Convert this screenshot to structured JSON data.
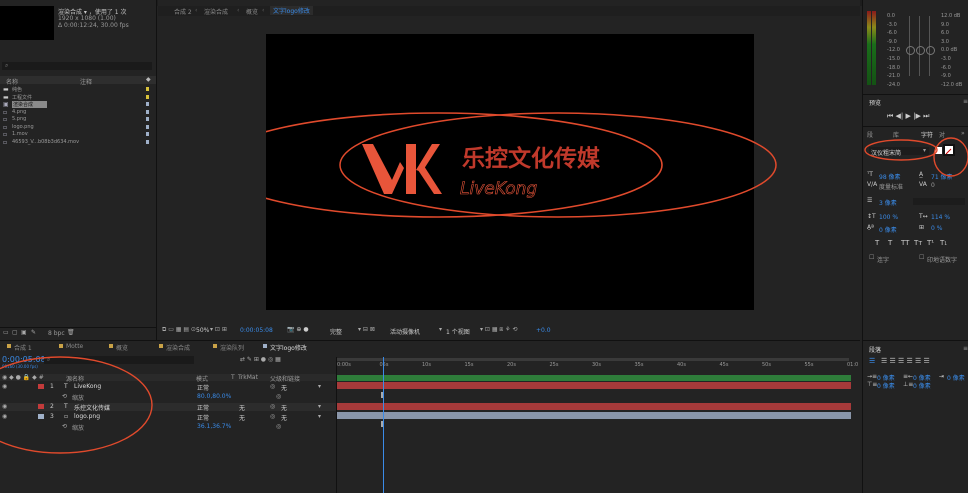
{
  "project": {
    "footage_info": [
      "渲染合成 ▾ ，使用了 1 次",
      "1920 x 1080 (1.00)",
      "Δ 0:00:12:24, 30.00 fps"
    ],
    "search_placeholder": "⌕",
    "col_name": "名称",
    "col_comment": "注释",
    "items": [
      {
        "name": "纯色",
        "type": "folder",
        "color": "#d8c23a"
      },
      {
        "name": "工程文件",
        "type": "folder",
        "color": "#d8c23a"
      },
      {
        "name": "渲染合成",
        "type": "comp",
        "color": "#9fb0c8",
        "selected": true
      },
      {
        "name": "4.png",
        "type": "file",
        "color": "#9fb0c8"
      },
      {
        "name": "5.png",
        "type": "file",
        "color": "#9fb0c8"
      },
      {
        "name": "logo.png",
        "type": "file",
        "color": "#9fb0c8"
      },
      {
        "name": "1.mov",
        "type": "file",
        "color": "#9fb0c8"
      },
      {
        "name": "46593_V...b08b3d634.mov",
        "type": "file",
        "color": "#9fb0c8"
      }
    ],
    "bpc": "8 bpc"
  },
  "comp": {
    "tabs": [
      "合成 2",
      "渲染合成",
      "概览",
      "文字logo修改"
    ],
    "logo_cn": "乐控文化传媒",
    "logo_en": "LiveKong",
    "toolbar": {
      "zoom": "50%",
      "timecode": "0:00:05:08",
      "quality": "完整",
      "camera": "活动摄像机",
      "views": "1 个视图",
      "exposure": "+0.0"
    }
  },
  "audio": {
    "db_left": [
      "0.0",
      "-3.0",
      "-6.0",
      "-9.0",
      "-12.0",
      "-15.0",
      "-18.0",
      "-21.0",
      "-24.0"
    ],
    "db_right": [
      "12.0 dB",
      "9.0",
      "6.0",
      "3.0",
      "0.0 dB",
      "-3.0",
      "-6.0",
      "-9.0",
      "-12.0 dB"
    ],
    "extra": "0.0"
  },
  "preview": {
    "title": "预览"
  },
  "character": {
    "tabs": [
      "段",
      "库",
      "字符",
      "对"
    ],
    "font": "汉仪粗宋简",
    "size": "98 像素",
    "leading": "71 像素",
    "kerning": "度量标准",
    "tracking": "0",
    "stroke": "3 像素",
    "vscale": "100 %",
    "hscale": "114 %",
    "baseline": "0 像素",
    "tsume": "0 %",
    "styles": [
      "T",
      "T",
      "TT",
      "Tт",
      "T¹",
      "T₁"
    ],
    "ligatures": "连字",
    "hindi": "印地语数字"
  },
  "timeline": {
    "tabs": [
      "合成 1",
      "Motte",
      "概览",
      "渲染合成",
      "渲染队列",
      "文字logo修改"
    ],
    "timecode": "0:00:05:08",
    "fps": "00160 (30.00 fps)",
    "headers": [
      "源名称",
      "模式",
      "T",
      "TrkMat",
      "父级和链接"
    ],
    "layers": [
      {
        "num": "1",
        "name": "LiveKong",
        "mode": "正常",
        "trk": "",
        "parent": "无",
        "color": "#c23b3b",
        "type": "T"
      },
      {
        "num": "2",
        "name": "乐控文化传媒",
        "mode": "正常",
        "trk": "无",
        "parent": "无",
        "color": "#c23b3b",
        "type": "T"
      },
      {
        "num": "3",
        "name": "logo.png",
        "mode": "正常",
        "trk": "无",
        "parent": "无",
        "color": "#9fb0c8",
        "type": "img"
      }
    ],
    "scale_label": "缩放",
    "scale1": "80.0,80.0%",
    "scale3": "36.1,36.7%",
    "ruler": [
      "0:00s",
      "05s",
      "10s",
      "15s",
      "20s",
      "25s",
      "30s",
      "35s",
      "40s",
      "45s",
      "50s",
      "55s",
      "01:0"
    ]
  },
  "paragraph": {
    "title": "段落",
    "indent1": "0 像素",
    "indent2": "0 像素",
    "indent3": "0 像素",
    "space1": "0 像素",
    "space2": "0 像素"
  },
  "colors": {
    "accent": "#3a8be8",
    "annotation": "#e04a2c",
    "logo": "#e8553a",
    "layer_red": "#c23b3b"
  }
}
